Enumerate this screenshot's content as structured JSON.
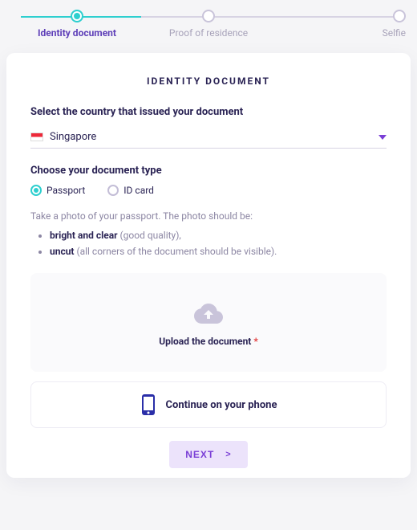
{
  "stepper": {
    "steps": [
      {
        "label": "Identity document",
        "active": true
      },
      {
        "label": "Proof of residence",
        "active": false
      },
      {
        "label": "Selfie",
        "active": false
      }
    ]
  },
  "card": {
    "title": "IDENTITY DOCUMENT",
    "country_section": {
      "label": "Select the country that issued your document",
      "selected": "Singapore"
    },
    "doc_type_section": {
      "label": "Choose your document type",
      "options": [
        {
          "label": "Passport",
          "checked": true
        },
        {
          "label": "ID card",
          "checked": false
        }
      ]
    },
    "instructions": {
      "lead": "Take a photo of your passport. The photo should be:",
      "bullets": [
        {
          "bold": "bright and clear",
          "rest": " (good quality),"
        },
        {
          "bold": "uncut",
          "rest": " (all corners of the document should be visible)."
        }
      ]
    },
    "upload": {
      "label": "Upload the document",
      "required_marker": " *"
    },
    "phone_continue": {
      "label": "Continue on your phone"
    },
    "next": {
      "label": "NEXT",
      "caret": ">"
    }
  }
}
